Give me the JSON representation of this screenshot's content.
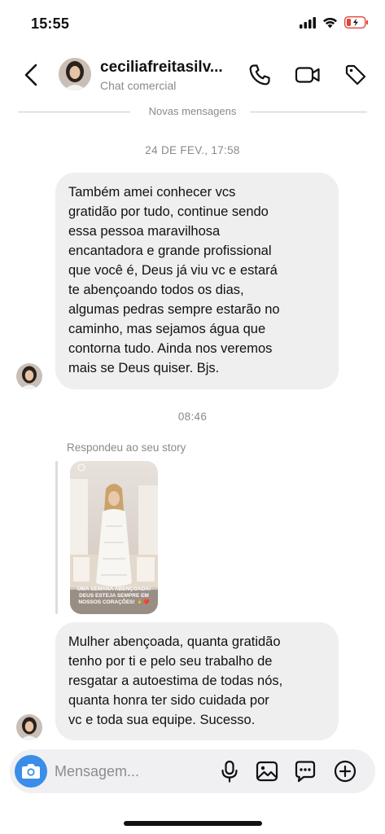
{
  "status_bar": {
    "time": "15:55"
  },
  "header": {
    "contact_name": "ceciliafreitasilv...",
    "subtitle": "Chat comercial",
    "icons": [
      "back-arrow-icon",
      "phone-icon",
      "video-icon",
      "tag-icon"
    ]
  },
  "conversation": {
    "new_messages_label": "Novas mensagens",
    "timestamp_1": "24 DE FEV., 17:58",
    "message_1": "Também  amei conhecer  vcs\ngratidão por tudo, continue sendo\nessa pessoa maravilhosa\nencantadora e grande profissional\nque você é,  Deus já  viu vc e estará\nte abençoando todos os dias,\nalgumas pedras sempre estarão no\ncaminho,  mas sejamos  água  que\ncontorna tudo. Ainda  nos veremos\nmais se Deus quiser. Bjs.",
    "timestamp_2": "08:46",
    "reply_label": "Respondeu ao seu story",
    "story_caption": "UMA SEMANA ABENÇOADA! DEUS ESTEJA SEMPRE EM NOSSOS CORAÇÕES! 🙏❤️",
    "message_2": "Mulher abençoada, quanta gratidão\ntenho por ti e pelo seu trabalho de\nresgatar a autoestima de todas nós,\nquanta honra ter sido cuidada por\nvc e toda sua equipe. Sucesso."
  },
  "composer": {
    "placeholder": "Mensagem...",
    "icons": [
      "camera-icon",
      "microphone-icon",
      "gallery-icon",
      "sticker-icon",
      "add-icon"
    ]
  },
  "colors": {
    "camera_button": "#3a8de8",
    "bubble": "#efeff0",
    "battery_low": "#e0453a",
    "muted_text": "#8a8a8a"
  }
}
